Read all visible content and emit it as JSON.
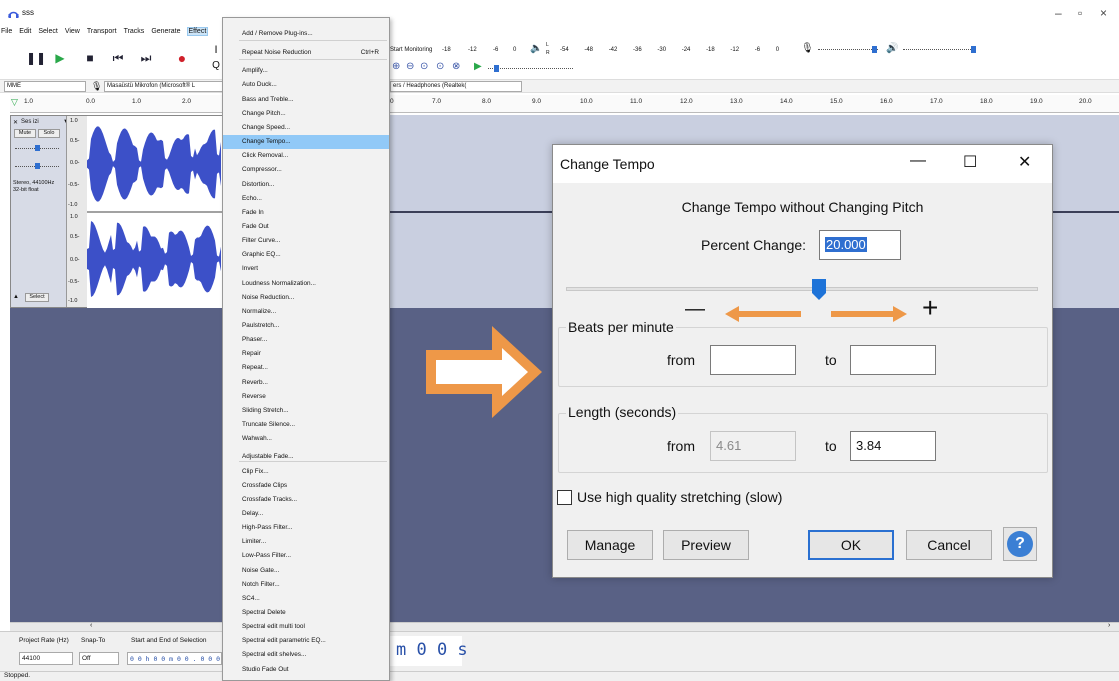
{
  "window": {
    "title": "sss",
    "controls": [
      "–",
      "▫",
      "×"
    ]
  },
  "menubar": [
    "File",
    "Edit",
    "Select",
    "View",
    "Transport",
    "Tracks",
    "Generate",
    "Effect"
  ],
  "toolbar": {
    "start_monitoring": "Start Monitoring",
    "meter_ticks": [
      "-18",
      "-12",
      "-6",
      "0"
    ],
    "meter_ticks2": [
      "-54",
      "-48",
      "-42",
      "-36",
      "-30",
      "-24",
      "-18",
      "-12",
      "-6",
      "0"
    ],
    "lr_label_l": "L",
    "lr_label_r": "R"
  },
  "devices": {
    "host": "MME",
    "mic": "Masaüstü Mikrofon (Microsoft® L",
    "speakers": "ers / Headphones (Realtek("
  },
  "ruler": {
    "left_ticks": [
      "1.0",
      "0.0",
      "1.0",
      "2.0"
    ],
    "right_ticks": [
      "0",
      "7.0",
      "8.0",
      "9.0",
      "10.0",
      "11.0",
      "12.0",
      "13.0",
      "14.0",
      "15.0",
      "16.0",
      "17.0",
      "18.0",
      "19.0",
      "20.0"
    ]
  },
  "track": {
    "name": "Ses izi",
    "mute": "Mute",
    "solo": "Solo",
    "info": "Stereo, 44100Hz\n32-bit float",
    "select": "Select",
    "scale_top": [
      "1.0",
      "0.5-",
      "0.0-",
      "-0.5-",
      "-1.0"
    ],
    "scale_bottom": [
      "1.0",
      "0.5-",
      "0.0-",
      "-0.5-",
      "-1.0"
    ]
  },
  "effect_menu": {
    "items": [
      {
        "label": "Add / Remove Plug-ins..."
      },
      {
        "label": "Repeat Noise Reduction",
        "shortcut": "Ctrl+R"
      },
      {
        "label": "Amplify..."
      },
      {
        "label": "Auto Duck..."
      },
      {
        "label": "Bass and Treble..."
      },
      {
        "label": "Change Pitch..."
      },
      {
        "label": "Change Speed..."
      },
      {
        "label": "Change Tempo...",
        "highlight": true
      },
      {
        "label": "Click Removal..."
      },
      {
        "label": "Compressor..."
      },
      {
        "label": "Distortion..."
      },
      {
        "label": "Echo..."
      },
      {
        "label": "Fade In"
      },
      {
        "label": "Fade Out"
      },
      {
        "label": "Filter Curve..."
      },
      {
        "label": "Graphic EQ..."
      },
      {
        "label": "Invert"
      },
      {
        "label": "Loudness Normalization..."
      },
      {
        "label": "Noise Reduction..."
      },
      {
        "label": "Normalize..."
      },
      {
        "label": "Paulstretch..."
      },
      {
        "label": "Phaser..."
      },
      {
        "label": "Repair"
      },
      {
        "label": "Repeat..."
      },
      {
        "label": "Reverb..."
      },
      {
        "label": "Reverse"
      },
      {
        "label": "Sliding Stretch..."
      },
      {
        "label": "Truncate Silence..."
      },
      {
        "label": "Wahwah..."
      },
      {
        "label": "Adjustable Fade..."
      },
      {
        "label": "Clip Fix..."
      },
      {
        "label": "Crossfade Clips"
      },
      {
        "label": "Crossfade Tracks..."
      },
      {
        "label": "Delay..."
      },
      {
        "label": "High-Pass Filter..."
      },
      {
        "label": "Limiter..."
      },
      {
        "label": "Low-Pass Filter..."
      },
      {
        "label": "Noise Gate..."
      },
      {
        "label": "Notch Filter..."
      },
      {
        "label": "SC4..."
      },
      {
        "label": "Spectral Delete"
      },
      {
        "label": "Spectral edit multi tool"
      },
      {
        "label": "Spectral edit parametric EQ..."
      },
      {
        "label": "Spectral edit shelves..."
      },
      {
        "label": "Studio Fade Out"
      }
    ]
  },
  "dialog": {
    "title": "Change Tempo",
    "heading": "Change Tempo without Changing Pitch",
    "percent_label": "Percent Change:",
    "percent_value": "20.000",
    "slider_value_percent": 20,
    "minus": "—",
    "plus": "+",
    "bpm_group": "Beats per minute",
    "length_group": "Length (seconds)",
    "from": "from",
    "to": "to",
    "bpm_from": "",
    "bpm_to": "",
    "len_from": "4.61",
    "len_to": "3.84",
    "hq_label": "Use high quality stretching (slow)",
    "hq_checked": false,
    "buttons": {
      "manage": "Manage",
      "preview": "Preview",
      "ok": "OK",
      "cancel": "Cancel",
      "help": "?"
    }
  },
  "selection": {
    "rate_label": "Project Rate (Hz)",
    "snap_label": "Snap-To",
    "sel_label": "Start and End of Selection",
    "rate": "44100",
    "snap": "Off",
    "time": "0 0 h 0 0 m 0 0 . 0 0 0 s",
    "big_time": "m 0 0 s"
  },
  "status": "Stopped.",
  "colors": {
    "accent_orange": "#ee9848",
    "highlight": "#91c9f7",
    "wave": "#3c50c8",
    "track_bg": "#596185",
    "help": "#3b7fd4"
  }
}
